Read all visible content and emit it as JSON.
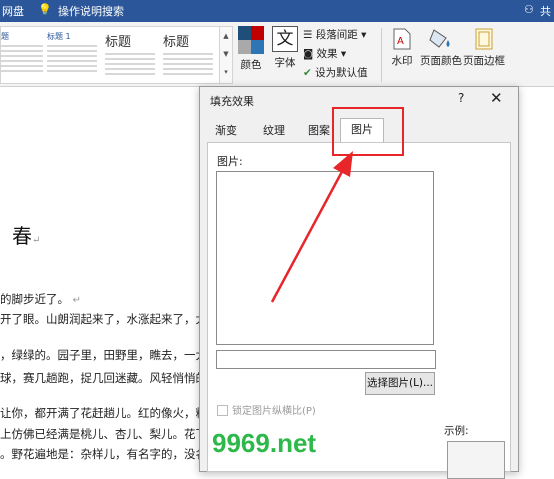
{
  "titlebar": {
    "left_fragment": "网盘",
    "tell_me": "操作说明搜索",
    "share": "共"
  },
  "style_gallery": [
    {
      "name": "标题",
      "small": true
    },
    {
      "name": "标题 1",
      "small": true
    },
    {
      "name": "标题",
      "small": false
    },
    {
      "name": "标题",
      "small": false
    }
  ],
  "ribbon": {
    "colors_label": "颜色",
    "fonts_label": "字体",
    "fonts_glyph": "文",
    "paragraph_spacing": "段落间距",
    "effects": "效果",
    "set_default": "设为默认值",
    "watermark": "水印",
    "page_color": "页面颜色",
    "page_borders": "页面边框"
  },
  "document": {
    "title": "春",
    "lines": [
      {
        "text": "的脚步近了。"
      },
      {
        "text": "开了眼。山朗润起来了，水涨起来了，太阳"
      },
      {
        "text": "，绿绿的。园子里，田野里，瞧去，一大片"
      },
      {
        "text": "球，赛几趟跑，捉几回迷藏。风轻悄悄的，"
      },
      {
        "text": "让你，都开满了花赶趟儿。红的像火，粉"
      },
      {
        "text": "上仿佛已经满是桃儿、杏儿、梨儿。花下"
      },
      {
        "text": "。野花遍地是：杂样儿，有名字的，没名"
      }
    ]
  },
  "dialog": {
    "title": "填充效果",
    "help": "?",
    "close": "✕",
    "tabs": [
      {
        "label": "渐变",
        "active": false
      },
      {
        "label": "纹理",
        "active": false
      },
      {
        "label": "图案",
        "active": false
      },
      {
        "label": "图片",
        "active": true
      }
    ],
    "picture_label": "图片:",
    "picture_path": "",
    "select_button": "选择图片(L)...",
    "lock_aspect_label": "锁定图片纵横比(P)",
    "lock_aspect_checked": false,
    "sample_label": "示例:"
  },
  "annotation": {
    "color": "#e8262a"
  },
  "watermark_text": "9969.net"
}
